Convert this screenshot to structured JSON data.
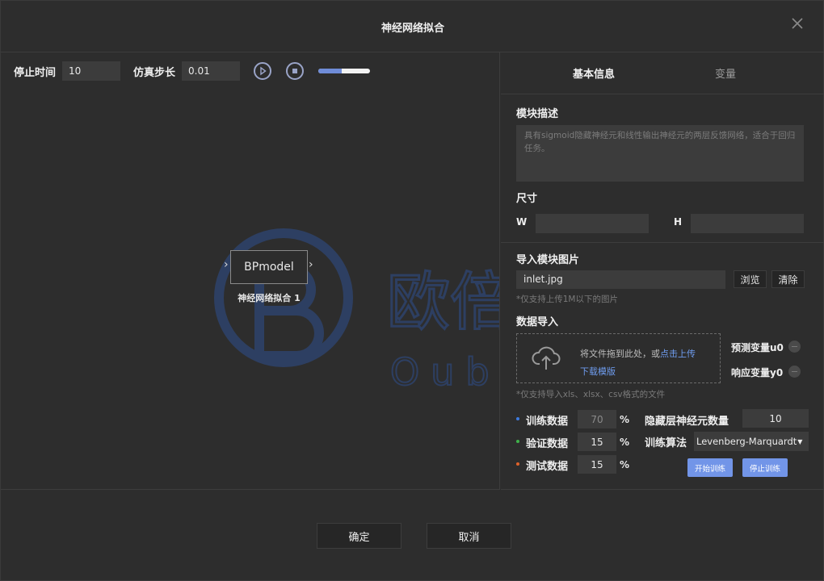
{
  "dialog": {
    "title": "神经网络拟合"
  },
  "toolbar": {
    "stop_time_label": "停止时间",
    "stop_time_value": "10",
    "step_label": "仿真步长",
    "step_value": "0.01",
    "progress": 0.45
  },
  "canvas": {
    "watermark_cn": "欧倍尔",
    "watermark_en": "Oubeier",
    "block_name": "BPmodel",
    "block_label": "神经网络拟合 1"
  },
  "tabs": {
    "basic": "基本信息",
    "variables": "变量"
  },
  "module": {
    "desc_label": "模块描述",
    "desc_placeholder": "具有sigmoid隐藏神经元和线性输出神经元的两层反馈网络，适合于回归任务。",
    "size_label": "尺寸",
    "w_label": "W",
    "h_label": "H",
    "image_label": "导入模块图片",
    "image_file": "inlet.jpg",
    "browse": "浏览",
    "clear": "清除",
    "image_hint": "*仅支持上传1M以下的图片"
  },
  "data_import": {
    "label": "数据导入",
    "drop_text": "将文件拖到此处，或",
    "upload_link": "点击上传",
    "template_link": "下载模版",
    "hint": "*仅支持导入xls、xlsx、csv格式的文件",
    "predict_var": "预测变量u0",
    "response_var": "响应变量y0"
  },
  "split": {
    "train_label": "训练数据",
    "train_value": "70",
    "valid_label": "验证数据",
    "valid_value": "15",
    "test_label": "测试数据",
    "test_value": "15",
    "pct": "%",
    "colors": {
      "train": "#3d7be0",
      "valid": "#3fb24a",
      "test": "#e0622a"
    }
  },
  "training": {
    "hidden_label": "隐藏层神经元数量",
    "hidden_value": "10",
    "algo_label": "训练算法",
    "algo_value": "Levenberg-Marquardt",
    "start": "开始训练",
    "stop": "停止训练"
  },
  "footer": {
    "ok": "确定",
    "cancel": "取消"
  }
}
